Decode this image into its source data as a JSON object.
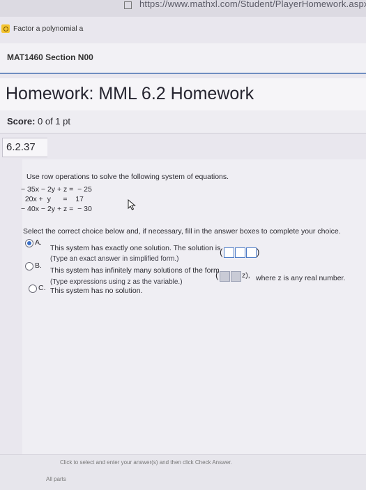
{
  "browser": {
    "url": "https://www.mathxl.com/Student/PlayerHomework.aspx?"
  },
  "bookmark": {
    "label": "Factor a polynomial a"
  },
  "course": {
    "title": "MAT1460 Section N00"
  },
  "homework": {
    "title": "Homework: MML 6.2 Homework",
    "score_label": "Score:",
    "score_value": "0 of 1 pt",
    "question_number": "6.2.37"
  },
  "question": {
    "instructions": "Use row operations to solve the following system of equations.",
    "equations": [
      "− 35x − 2y + z =  − 25",
      "  20x +  y      =    17",
      "− 40x − 2y + z =  − 30"
    ],
    "select_prompt": "Select the correct choice below and, if necessary, fill in the answer boxes to complete your choice.",
    "choices": [
      {
        "letter": "A.",
        "text": "This system has exactly one solution. The solution is",
        "note": "(Type an exact answer in simplified form.)",
        "selected": true
      },
      {
        "letter": "B.",
        "text": "This system has infinitely many solutions of the form",
        "form_tail": "z),",
        "tail": "where z is any real number.",
        "note": "(Type expressions using z as the variable.)",
        "selected": false
      },
      {
        "letter": "C.",
        "text": "This system has no solution.",
        "selected": false
      }
    ]
  },
  "footer": {
    "line1": "Click to select and enter your answer(s) and then click Check Answer.",
    "line2": "All parts"
  },
  "colors": {
    "accent": "#3a6fc7",
    "course_border": "#6f8ec0"
  }
}
